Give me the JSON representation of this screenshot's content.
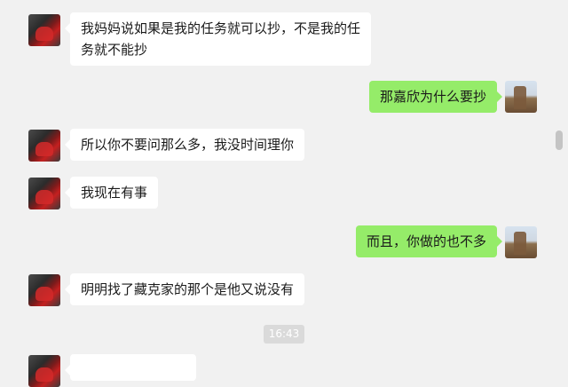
{
  "messages": [
    {
      "from": "other",
      "text": "我妈妈说如果是我的任务就可以抄，不是我的任务就不能抄"
    },
    {
      "from": "me",
      "text": "那嘉欣为什么要抄"
    },
    {
      "from": "other",
      "text": "所以你不要问那么多，我没时间理你"
    },
    {
      "from": "other",
      "text": "我现在有事"
    },
    {
      "from": "me",
      "text": "而且，你做的也不多"
    },
    {
      "from": "other",
      "text": "明明找了藏克家的那个是他又说没有"
    }
  ],
  "timestamp": "16:43",
  "colors": {
    "me_bubble": "#95ec69",
    "other_bubble": "#ffffff",
    "background": "#f1f1f1"
  }
}
